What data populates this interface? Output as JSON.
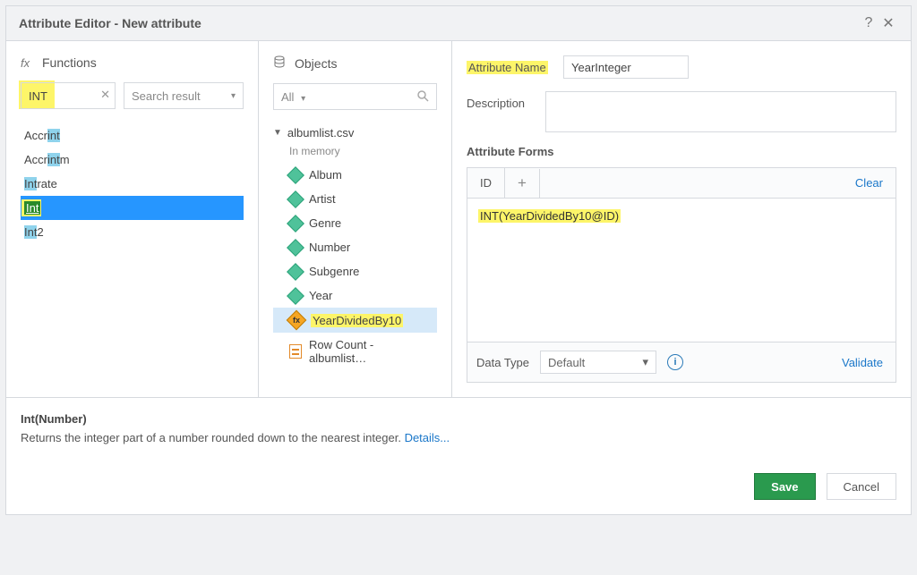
{
  "titlebar": {
    "title": "Attribute Editor - New attribute"
  },
  "functions": {
    "header": "Functions",
    "search_value": "INT",
    "scope_label": "Search result",
    "items": [
      {
        "pre": "Accr",
        "match": "int",
        "post": ""
      },
      {
        "pre": "Accr",
        "match": "int",
        "post": "m"
      },
      {
        "pre": "",
        "match": "Int",
        "post": "rate"
      },
      {
        "pre": "",
        "match": "Int",
        "post": "",
        "selected": true
      },
      {
        "pre": "",
        "match": "Int",
        "post": "2"
      }
    ]
  },
  "objects": {
    "header": "Objects",
    "filter_label": "All",
    "dataset": "albumlist.csv",
    "status": "In memory",
    "items": [
      {
        "type": "attr",
        "label": "Album"
      },
      {
        "type": "attr",
        "label": "Artist"
      },
      {
        "type": "attr",
        "label": "Genre"
      },
      {
        "type": "attr",
        "label": "Number"
      },
      {
        "type": "attr",
        "label": "Subgenre"
      },
      {
        "type": "attr",
        "label": "Year"
      },
      {
        "type": "fx",
        "label": "YearDividedBy10",
        "selected": true,
        "highlight": true
      },
      {
        "type": "rc",
        "label": "Row Count - albumlist…"
      }
    ]
  },
  "form": {
    "name_label": "Attribute Name",
    "name_value": "YearInteger",
    "desc_label": "Description",
    "desc_value": "",
    "forms_header": "Attribute Forms",
    "tab_id": "ID",
    "clear": "Clear",
    "expr": "INT(YearDividedBy10@ID)",
    "datatype_label": "Data Type",
    "datatype_value": "Default",
    "validate": "Validate"
  },
  "hint": {
    "signature": "Int(Number)",
    "text": "Returns the integer part of a number rounded down to the nearest integer. ",
    "link": "Details..."
  },
  "buttons": {
    "save": "Save",
    "cancel": "Cancel"
  }
}
